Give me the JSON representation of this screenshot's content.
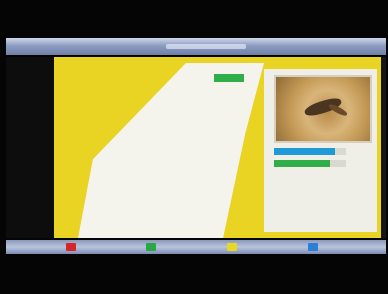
{
  "title_bar": {
    "title": ""
  },
  "parameters": [
    {
      "label": "",
      "value": ""
    },
    {
      "label": "",
      "value": ""
    },
    {
      "label": "",
      "value": ""
    },
    {
      "label": "",
      "value": ""
    },
    {
      "label": "",
      "value": ""
    },
    {
      "label": "",
      "value": ""
    },
    {
      "label": "",
      "value": ""
    },
    {
      "label": "",
      "value": ""
    },
    {
      "label": "",
      "value": ""
    },
    {
      "label": "",
      "value": ""
    },
    {
      "label": "",
      "value": ""
    },
    {
      "label": "",
      "value": ""
    },
    {
      "label": "",
      "value": ""
    },
    {
      "label": "",
      "value": ""
    },
    {
      "label": "",
      "value": ""
    },
    {
      "label": "",
      "value": ""
    },
    {
      "label": "",
      "value": ""
    },
    {
      "label": "",
      "value": ""
    },
    {
      "label": "",
      "value": ""
    }
  ],
  "signal": {
    "strength_fraction": 0.85,
    "quality_fraction": 0.78,
    "strength_value": "",
    "quality_value": ""
  },
  "info": [
    {
      "label": "",
      "value": ""
    },
    {
      "label": "",
      "value": ""
    },
    {
      "label": "",
      "value": ""
    },
    {
      "label": "",
      "value": ""
    },
    {
      "label": "",
      "value": ""
    }
  ],
  "function_keys": [
    {
      "color": "#d7262a",
      "label": ""
    },
    {
      "color": "#2aa846",
      "label": ""
    },
    {
      "color": "#e8d824",
      "label": ""
    },
    {
      "color": "#2a7fd6",
      "label": ""
    }
  ],
  "colors": {
    "panel_yellow": "#e9d323",
    "title_blue": "#8d9cc0",
    "signal_blue": "#1d9ad7",
    "signal_green": "#2fae4a"
  }
}
